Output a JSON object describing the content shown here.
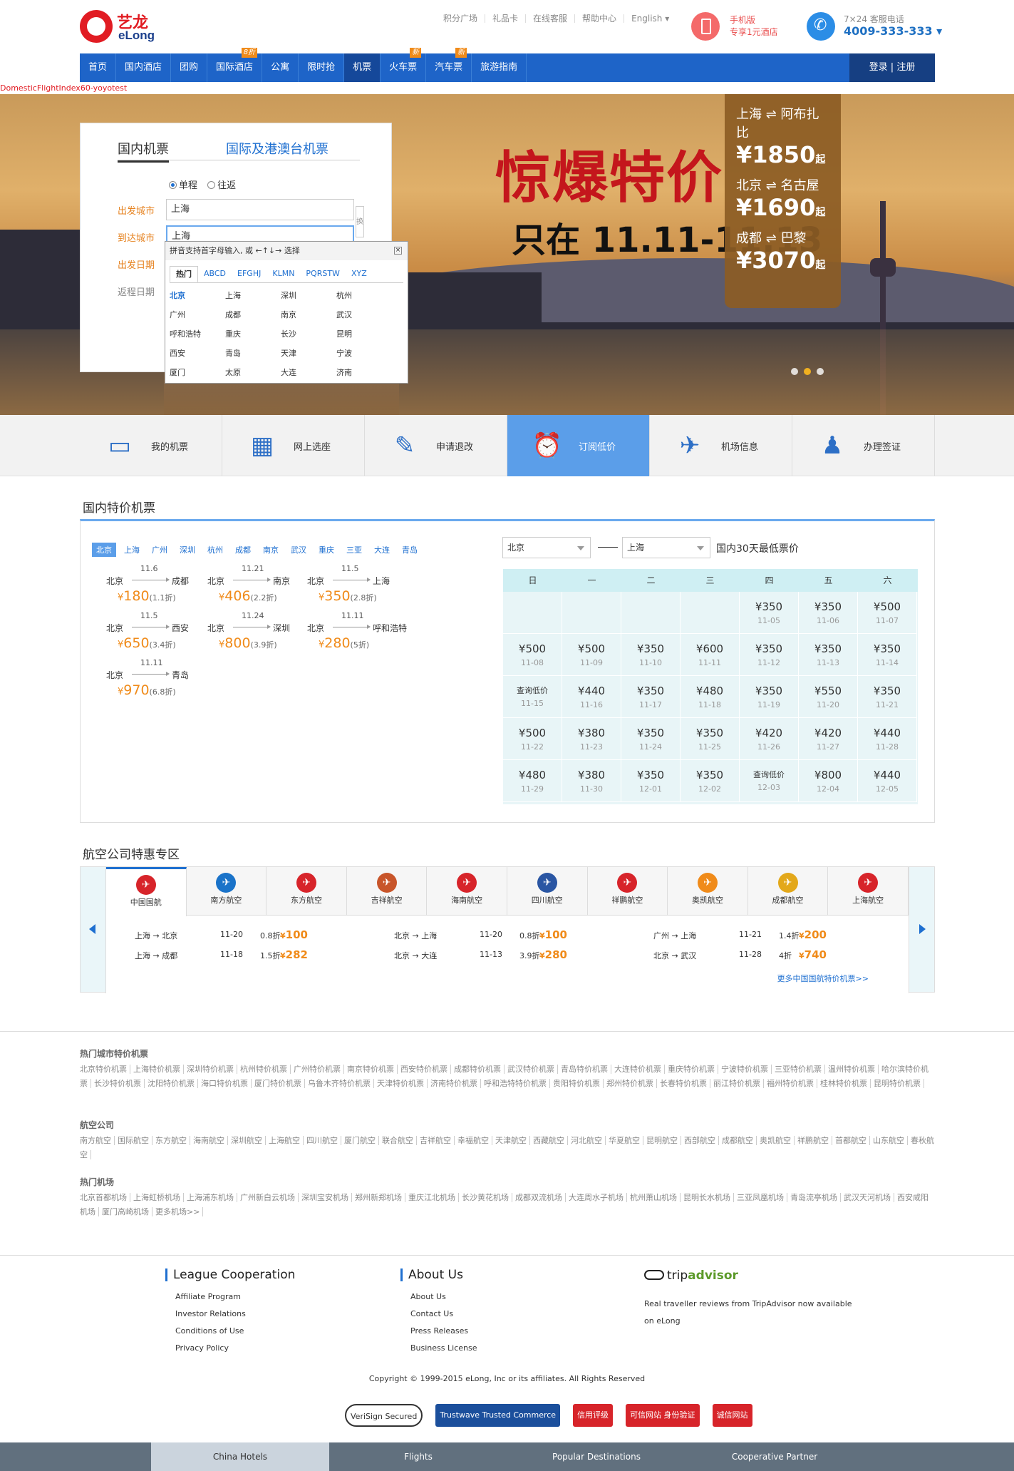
{
  "brand": {
    "cn": "艺龙",
    "en": "eLong"
  },
  "toplinks": [
    "积分广场",
    "礼品卡",
    "在线客服",
    "帮助中心",
    "English ▾"
  ],
  "mobile": {
    "line1": "手机版",
    "line2": "专享1元酒店"
  },
  "service": {
    "line1": "7×24 客服电话",
    "phone": "4009-333-333 ▾"
  },
  "nav": {
    "items": [
      {
        "label": "首页",
        "badge": ""
      },
      {
        "label": "国内酒店",
        "badge": ""
      },
      {
        "label": "团购",
        "badge": ""
      },
      {
        "label": "国际酒店",
        "badge": "8折"
      },
      {
        "label": "公寓",
        "badge": ""
      },
      {
        "label": "限时抢",
        "badge": ""
      },
      {
        "label": "机票",
        "badge": ""
      },
      {
        "label": "火车票",
        "badge": "新"
      },
      {
        "label": "汽车票",
        "badge": "新"
      },
      {
        "label": "旅游指南",
        "badge": ""
      }
    ],
    "login": "登录 | 注册"
  },
  "debug_text": "DomesticFlightIndex60-yoyotest",
  "banner": {
    "headline": "惊爆特价",
    "subline": "只在 11.11-11.13",
    "promos": [
      {
        "route": "上海 ⇌ 阿布扎比",
        "price": "¥1850",
        "suffix": "起"
      },
      {
        "route": "北京 ⇌ 名古屋",
        "price": "¥1690",
        "suffix": "起"
      },
      {
        "route": "成都 ⇌ 巴黎",
        "price": "¥3070",
        "suffix": "起"
      }
    ]
  },
  "search": {
    "tab_domestic": "国内机票",
    "tab_intl": "国际及港澳台机票",
    "oneway": "单程",
    "roundtrip": "往返",
    "from_label": "出发城市",
    "to_label": "到达城市",
    "date_label": "出发日期",
    "return_label": "返程日期",
    "from_value": "上海",
    "to_value": "上海",
    "swap": "换"
  },
  "citybox": {
    "hint": "拼音支持首字母输入, 或 ←↑↓→ 选择",
    "tabs": [
      "热门",
      "ABCD",
      "EFGHJ",
      "KLMN",
      "PQRSTW",
      "XYZ"
    ],
    "cities": [
      "北京",
      "上海",
      "深圳",
      "杭州",
      "广州",
      "成都",
      "南京",
      "武汉",
      "呼和浩特",
      "重庆",
      "长沙",
      "昆明",
      "西安",
      "青岛",
      "天津",
      "宁波",
      "厦门",
      "太原",
      "大连",
      "济南"
    ]
  },
  "functions": [
    "我的机票",
    "网上选座",
    "申请退改",
    "订阅低价",
    "机场信息",
    "办理签证"
  ],
  "deals": {
    "title": "国内特价机票",
    "cities": [
      "北京",
      "上海",
      "广州",
      "深圳",
      "杭州",
      "成都",
      "南京",
      "武汉",
      "重庆",
      "三亚",
      "大连",
      "青岛"
    ],
    "items": [
      {
        "from": "北京",
        "to": "成都",
        "date": "11.6",
        "price": "180",
        "discount": "(1.1折)"
      },
      {
        "from": "北京",
        "to": "南京",
        "date": "11.21",
        "price": "406",
        "discount": "(2.2折)"
      },
      {
        "from": "北京",
        "to": "上海",
        "date": "11.5",
        "price": "350",
        "discount": "(2.8折)"
      },
      {
        "from": "北京",
        "to": "西安",
        "date": "11.5",
        "price": "650",
        "discount": "(3.4折)"
      },
      {
        "from": "北京",
        "to": "深圳",
        "date": "11.24",
        "price": "800",
        "discount": "(3.9折)"
      },
      {
        "from": "北京",
        "to": "呼和浩特",
        "date": "11.11",
        "price": "280",
        "discount": "(5折)"
      },
      {
        "from": "北京",
        "to": "青岛",
        "date": "11.11",
        "price": "970",
        "discount": "(6.8折)"
      }
    ]
  },
  "calendar": {
    "from": "北京",
    "to": "上海",
    "label": "国内30天最低票价",
    "weekdays": [
      "日",
      "一",
      "二",
      "三",
      "四",
      "五",
      "六"
    ],
    "cells": [
      {
        "p": "",
        "d": ""
      },
      {
        "p": "",
        "d": ""
      },
      {
        "p": "",
        "d": ""
      },
      {
        "p": "",
        "d": ""
      },
      {
        "p": "¥350",
        "d": "11-05"
      },
      {
        "p": "¥350",
        "d": "11-06"
      },
      {
        "p": "¥500",
        "d": "11-07"
      },
      {
        "p": "¥500",
        "d": "11-08"
      },
      {
        "p": "¥500",
        "d": "11-09"
      },
      {
        "p": "¥350",
        "d": "11-10"
      },
      {
        "p": "¥600",
        "d": "11-11"
      },
      {
        "p": "¥350",
        "d": "11-12"
      },
      {
        "p": "¥350",
        "d": "11-13"
      },
      {
        "p": "¥350",
        "d": "11-14"
      },
      {
        "p": "查询低价",
        "d": "11-15"
      },
      {
        "p": "¥440",
        "d": "11-16"
      },
      {
        "p": "¥350",
        "d": "11-17"
      },
      {
        "p": "¥480",
        "d": "11-18"
      },
      {
        "p": "¥350",
        "d": "11-19"
      },
      {
        "p": "¥550",
        "d": "11-20"
      },
      {
        "p": "¥350",
        "d": "11-21"
      },
      {
        "p": "¥500",
        "d": "11-22"
      },
      {
        "p": "¥380",
        "d": "11-23"
      },
      {
        "p": "¥350",
        "d": "11-24"
      },
      {
        "p": "¥350",
        "d": "11-25"
      },
      {
        "p": "¥420",
        "d": "11-26"
      },
      {
        "p": "¥420",
        "d": "11-27"
      },
      {
        "p": "¥440",
        "d": "11-28"
      },
      {
        "p": "¥480",
        "d": "11-29"
      },
      {
        "p": "¥380",
        "d": "11-30"
      },
      {
        "p": "¥350",
        "d": "12-01"
      },
      {
        "p": "¥350",
        "d": "12-02"
      },
      {
        "p": "查询低价",
        "d": "12-03"
      },
      {
        "p": "¥800",
        "d": "12-04"
      },
      {
        "p": "¥440",
        "d": "12-05"
      }
    ]
  },
  "airlines": {
    "title": "航空公司特惠专区",
    "tabs": [
      {
        "name": "中国国航",
        "color": "#d7242a"
      },
      {
        "name": "南方航空",
        "color": "#1a73c9"
      },
      {
        "name": "东方航空",
        "color": "#d7242a"
      },
      {
        "name": "吉祥航空",
        "color": "#c8552a"
      },
      {
        "name": "海南航空",
        "color": "#d7242a"
      },
      {
        "name": "四川航空",
        "color": "#2a56a3"
      },
      {
        "name": "祥鹏航空",
        "color": "#d7242a"
      },
      {
        "name": "奥凯航空",
        "color": "#f08b1a"
      },
      {
        "name": "成都航空",
        "color": "#e3a81a"
      },
      {
        "name": "上海航空",
        "color": "#d7242a"
      }
    ],
    "flights": [
      {
        "route": "上海 → 北京",
        "date": "11-20",
        "discount": "0.8折",
        "price": "100"
      },
      {
        "route": "北京 → 上海",
        "date": "11-20",
        "discount": "0.8折",
        "price": "100"
      },
      {
        "route": "广州 → 上海",
        "date": "11-21",
        "discount": "1.4折",
        "price": "200"
      },
      {
        "route": "上海 → 成都",
        "date": "11-18",
        "discount": "1.5折",
        "price": "282"
      },
      {
        "route": "北京 → 大连",
        "date": "11-13",
        "discount": "3.9折",
        "price": "280"
      },
      {
        "route": "北京 → 武汉",
        "date": "11-28",
        "discount": "4折",
        "price": "740"
      }
    ],
    "more": "更多中国国航特价机票>>"
  },
  "seo": {
    "hot_cities_title": "热门城市特价机票",
    "hot_cities": [
      "北京特价机票",
      "上海特价机票",
      "深圳特价机票",
      "杭州特价机票",
      "广州特价机票",
      "南京特价机票",
      "西安特价机票",
      "成都特价机票",
      "武汉特价机票",
      "青岛特价机票",
      "大连特价机票",
      "重庆特价机票",
      "宁波特价机票",
      "三亚特价机票",
      "温州特价机票",
      "哈尔滨特价机票",
      "长沙特价机票",
      "沈阳特价机票",
      "海口特价机票",
      "厦门特价机票",
      "乌鲁木齐特价机票",
      "天津特价机票",
      "济南特价机票",
      "呼和浩特特价机票",
      "贵阳特价机票",
      "郑州特价机票",
      "长春特价机票",
      "丽江特价机票",
      "福州特价机票",
      "桂林特价机票",
      "昆明特价机票"
    ],
    "airlines_title": "航空公司",
    "airlines": [
      "南方航空",
      "国际航空",
      "东方航空",
      "海南航空",
      "深圳航空",
      "上海航空",
      "四川航空",
      "厦门航空",
      "联合航空",
      "吉祥航空",
      "幸福航空",
      "天津航空",
      "西藏航空",
      "河北航空",
      "华夏航空",
      "昆明航空",
      "西部航空",
      "成都航空",
      "奥凯航空",
      "祥鹏航空",
      "首都航空",
      "山东航空",
      "春秋航空"
    ],
    "airports_title": "热门机场",
    "airports": [
      "北京首都机场",
      "上海虹桥机场",
      "上海浦东机场",
      "广州新白云机场",
      "深圳宝安机场",
      "郑州新郑机场",
      "重庆江北机场",
      "长沙黄花机场",
      "成都双流机场",
      "大连周水子机场",
      "杭州萧山机场",
      "昆明长水机场",
      "三亚凤凰机场",
      "青岛流亭机场",
      "武汉天河机场",
      "西安咸阳机场",
      "厦门高崎机场",
      "更多机场>>"
    ]
  },
  "footer": {
    "league_title": "League Cooperation",
    "league": [
      "Affiliate Program",
      "Investor Relations",
      "Conditions of Use",
      "Privacy Policy"
    ],
    "about_title": "About Us",
    "about": [
      "About Us",
      "Contact Us",
      "Press Releases",
      "Business License"
    ],
    "ta_logo_a": "trip",
    "ta_logo_b": "advisor",
    "ta_text": "Real traveller reviews from TripAdvisor now available on eLong",
    "copyright": "Copyright © 1999-2015 eLong, Inc or its affiliates. All Rights Reserved",
    "badges": [
      "VeriSign Secured",
      "Trustwave Trusted Commerce",
      "信用评级",
      "可信网站 身份验证",
      "诚信网站"
    ],
    "bottom_tabs": [
      "China Hotels",
      "Flights",
      "Popular Destinations",
      "Cooperative Partner"
    ]
  }
}
